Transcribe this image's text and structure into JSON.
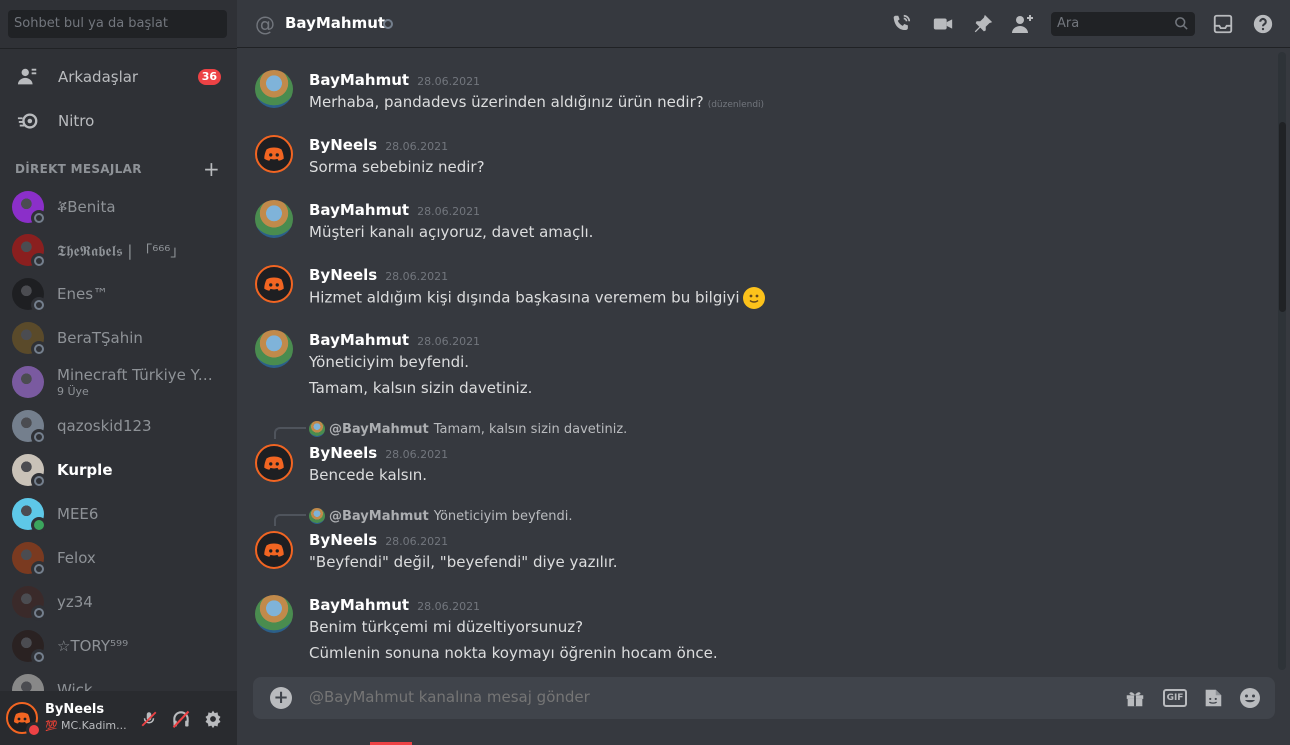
{
  "sidebar": {
    "search_placeholder": "Sohbet bul ya da başlat",
    "nav": [
      {
        "label": "Arkadaşlar",
        "badge": "36",
        "icon": "friends-icon"
      },
      {
        "label": "Nitro",
        "icon": "nitro-icon"
      }
    ],
    "dm_header": "DİREKT MESAJLAR",
    "dms": [
      {
        "name": "ቖBenita",
        "status": "offline",
        "color": "#8b2fc9"
      },
      {
        "name": "𝕿𝖍𝖊𝕽𝖆𝖇𝖊𝖑𝖘 | 「⁶⁶⁶」",
        "status": "offline",
        "color": "#8a1f1f"
      },
      {
        "name": "Enes™",
        "status": "offline",
        "color": "#1e1f22"
      },
      {
        "name": "BeraTŞahin",
        "status": "offline",
        "color": "#5a4a2a"
      },
      {
        "name": "Minecraft Türkiye Ya...",
        "sub": "9 Üye",
        "status": "none",
        "color": "#7a5aa0"
      },
      {
        "name": "qazoskid123",
        "status": "offline",
        "color": "#747f8d"
      },
      {
        "name": "Kurple",
        "status": "offline",
        "color": "#c9c2b8",
        "active": true
      },
      {
        "name": "MEE6",
        "status": "online",
        "color": "#5ec8e8"
      },
      {
        "name": "Felox",
        "status": "offline",
        "color": "#7a3a20"
      },
      {
        "name": "yz34",
        "status": "offline",
        "color": "#3a2a2a"
      },
      {
        "name": "☆TORY⁵⁹⁹",
        "status": "offline",
        "color": "#2a2222"
      },
      {
        "name": "Wick",
        "status": "offline",
        "color": "#888888"
      }
    ]
  },
  "user": {
    "name": "ByNeels",
    "status_text": "MC.Kadim...",
    "status_emoji": "💯"
  },
  "header": {
    "channel_name": "BayMahmut",
    "search_placeholder": "Ara"
  },
  "messages": [
    {
      "author": "BayMahmut",
      "time": "28.06.2021",
      "lines": [
        "Merhaba, pandadevs üzerinden aldığınız ürün nedir?"
      ],
      "edited": "(düzenlendi)",
      "avatar": "bay"
    },
    {
      "author": "ByNeels",
      "time": "28.06.2021",
      "lines": [
        "Sorma sebebiniz nedir?"
      ],
      "avatar": "dc"
    },
    {
      "author": "BayMahmut",
      "time": "28.06.2021",
      "lines": [
        "Müşteri kanalı açıyoruz, davet amaçlı."
      ],
      "avatar": "bay"
    },
    {
      "author": "ByNeels",
      "time": "28.06.2021",
      "lines": [
        "Hizmet aldığım kişi dışında başkasına veremem bu bilgiyi"
      ],
      "avatar": "dc"
    },
    {
      "author": "BayMahmut",
      "time": "28.06.2021",
      "lines": [
        "Yöneticiyim beyfendi.",
        "Tamam, kalsın sizin davetiniz."
      ],
      "avatar": "bay"
    },
    {
      "author": "ByNeels",
      "time": "28.06.2021",
      "lines": [
        "Bencede kalsın."
      ],
      "avatar": "dc",
      "reply": {
        "name": "@BayMahmut",
        "text": "Tamam, kalsın sizin davetiniz."
      }
    },
    {
      "author": "ByNeels",
      "time": "28.06.2021",
      "lines": [
        "\"Beyfendi\" değil, \"beyefendi\" diye yazılır."
      ],
      "avatar": "dc",
      "reply": {
        "name": "@BayMahmut",
        "text": "Yöneticiyim beyfendi."
      }
    },
    {
      "author": "BayMahmut",
      "time": "28.06.2021",
      "lines": [
        "Benim türkçemi mi düzeltiyorsunuz?",
        "Cümlenin sonuna nokta koymayı öğrenin hocam önce."
      ],
      "avatar": "bay"
    }
  ],
  "composer": {
    "placeholder": "@BayMahmut kanalına mesaj gönder",
    "gif_label": "GIF"
  },
  "colors": {
    "accent_red": "#ed4245",
    "online": "#3ba55d",
    "discord_orange": "#f26522"
  }
}
